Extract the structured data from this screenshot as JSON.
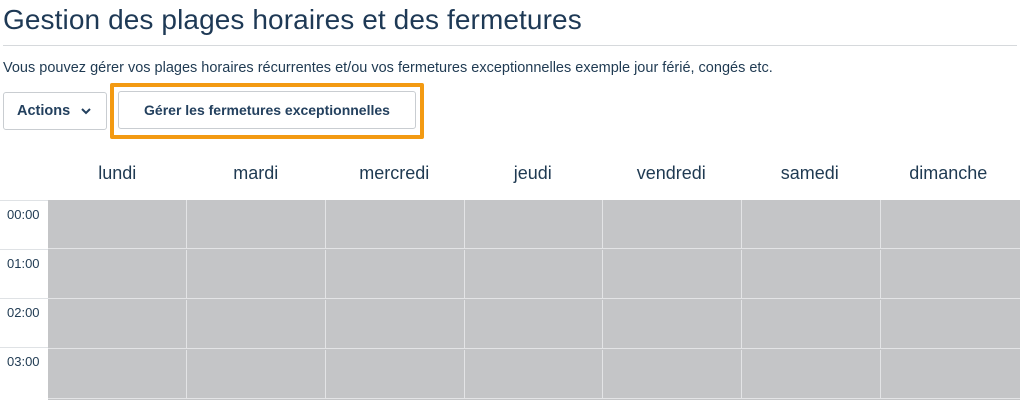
{
  "header": {
    "title": "Gestion des plages horaires et des fermetures",
    "description": "Vous pouvez gérer vos plages horaires récurrentes et/ou vos fermetures exceptionnelles exemple jour férié, congés etc."
  },
  "toolbar": {
    "actions_label": "Actions",
    "actions_icon": "chevron-down-icon",
    "closures_label": "Gérer les fermetures exceptionnelles",
    "highlight_color": "#f39a12"
  },
  "calendar": {
    "days": [
      "lundi",
      "mardi",
      "mercredi",
      "jeudi",
      "vendredi",
      "samedi",
      "dimanche"
    ],
    "hours": [
      "00:00",
      "01:00",
      "02:00",
      "03:00"
    ],
    "slot_color": "#c4c5c7"
  }
}
